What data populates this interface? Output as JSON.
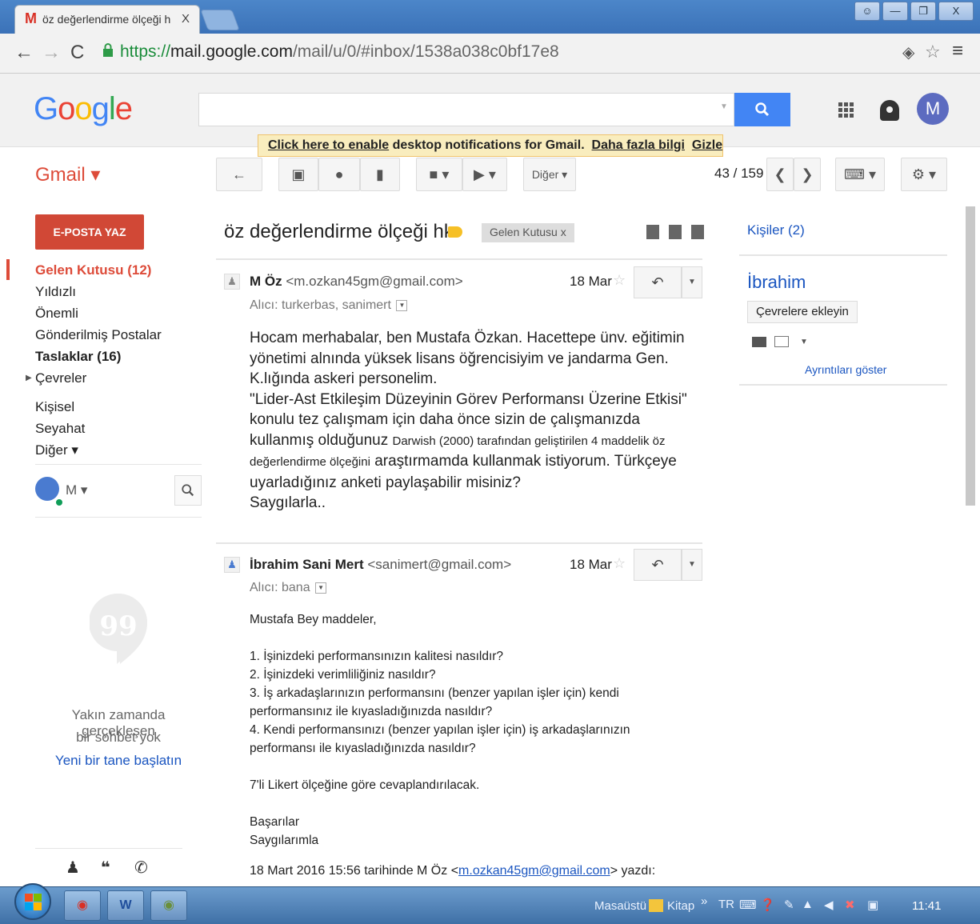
{
  "browser": {
    "tab_title": "öz değerlendirme ölçeği h",
    "tab_close": "X",
    "url_scheme": "https://",
    "url_domain": "mail.google.com",
    "url_path": "/mail/u/0/#inbox/1538a038c0bf17e8"
  },
  "google": {
    "logo": "Google",
    "avatar_letter": "M",
    "search_placeholder": ""
  },
  "notification": {
    "link1": "Click here to enable",
    "text": " desktop notifications for Gmail.",
    "link2": "Daha fazla bilgi",
    "link3": "Gizle"
  },
  "toolbar": {
    "gmail_label": "Gmail ▾",
    "more_label": "Diğer ▾",
    "pager": "43 / 159"
  },
  "nav": {
    "compose": "E-POSTA YAZ",
    "items": [
      "Gelen Kutusu (12)",
      "Yıldızlı",
      "Önemli",
      "Gönderilmiş Postalar",
      "Taslaklar (16)",
      "Çevreler",
      "Kişisel",
      "Seyahat",
      "Diğer ▾"
    ],
    "hangout_name": "M ▾",
    "chat_empty_line1": "Yakın zamanda gerçekleşen",
    "chat_empty_line2": "bir sohbet yok",
    "chat_start": "Yeni bir tane başlatın"
  },
  "thread": {
    "subject": "öz değerlendirme ölçeği hk.",
    "label_chip": "Gelen Kutusu   x",
    "messages": [
      {
        "sender_name": "M Öz",
        "sender_email": " <m.ozkan45gm@gmail.com>",
        "date": "18 Mar",
        "to": "Alıcı: turkerbas, sanimert",
        "body_lines": [
          "Hocam merhabalar, ben Mustafa Özkan. Hacettepe ünv. eğitimin",
          "yönetimi alnında yüksek lisans öğrencisiyim ve jandarma Gen.",
          "K.lığında askeri personelim.",
          "\"Lider-Ast Etkileşim Düzeyinin Görev Performansı Üzerine Etkisi\"",
          "konulu tez çalışmam için daha önce sizin de çalışmanızda",
          "kullanmış olduğunuz ",
          "Darwish (2000) tarafından geliştirilen 4 maddelik öz",
          "değerlendirme ölçeğini",
          " araştırmamda kullanmak istiyorum. Türkçeye",
          "uyarladığınız anketi paylaşabilir misiniz?",
          "Saygılarla.."
        ]
      },
      {
        "sender_name": "İbrahim Sani Mert",
        "sender_email": " <sanimert@gmail.com>",
        "date": "18 Mar",
        "to": "Alıcı: bana",
        "body_lines": [
          "Mustafa Bey maddeler,",
          "",
          "1. İşinizdeki performansınızın kalitesi nasıldır?",
          "2. İşinizdeki verimliliğiniz nasıldır?",
          "3. İş arkadaşlarınızın performansını (benzer yapılan işler için) kendi",
          "performansınız ile kıyasladığınızda nasıldır?",
          "4. Kendi performansınızı (benzer yapılan  işler için) iş arkadaşlarınızın",
          "performansı ile kıyasladığınızda nasıldır?",
          "",
          "7'li Likert ölçeğine göre cevaplandırılacak.",
          "",
          "Başarılar",
          "Saygılarımla"
        ],
        "quote_prefix": "18 Mart 2016 15:56 tarihinde M Öz <",
        "quote_link": "m.ozkan45gm@gmail.com",
        "quote_suffix": "> yazdı:"
      }
    ]
  },
  "people": {
    "header": "Kişiler (2)",
    "contact_name": "İbrahim",
    "add_to_circles": "Çevrelere ekleyin",
    "details_link": "Ayrıntıları göster"
  },
  "taskbar": {
    "desktop": "Masaüstü",
    "kitap": "Kitap",
    "chevron": "»",
    "lang": "TR",
    "clock": "11:41"
  }
}
